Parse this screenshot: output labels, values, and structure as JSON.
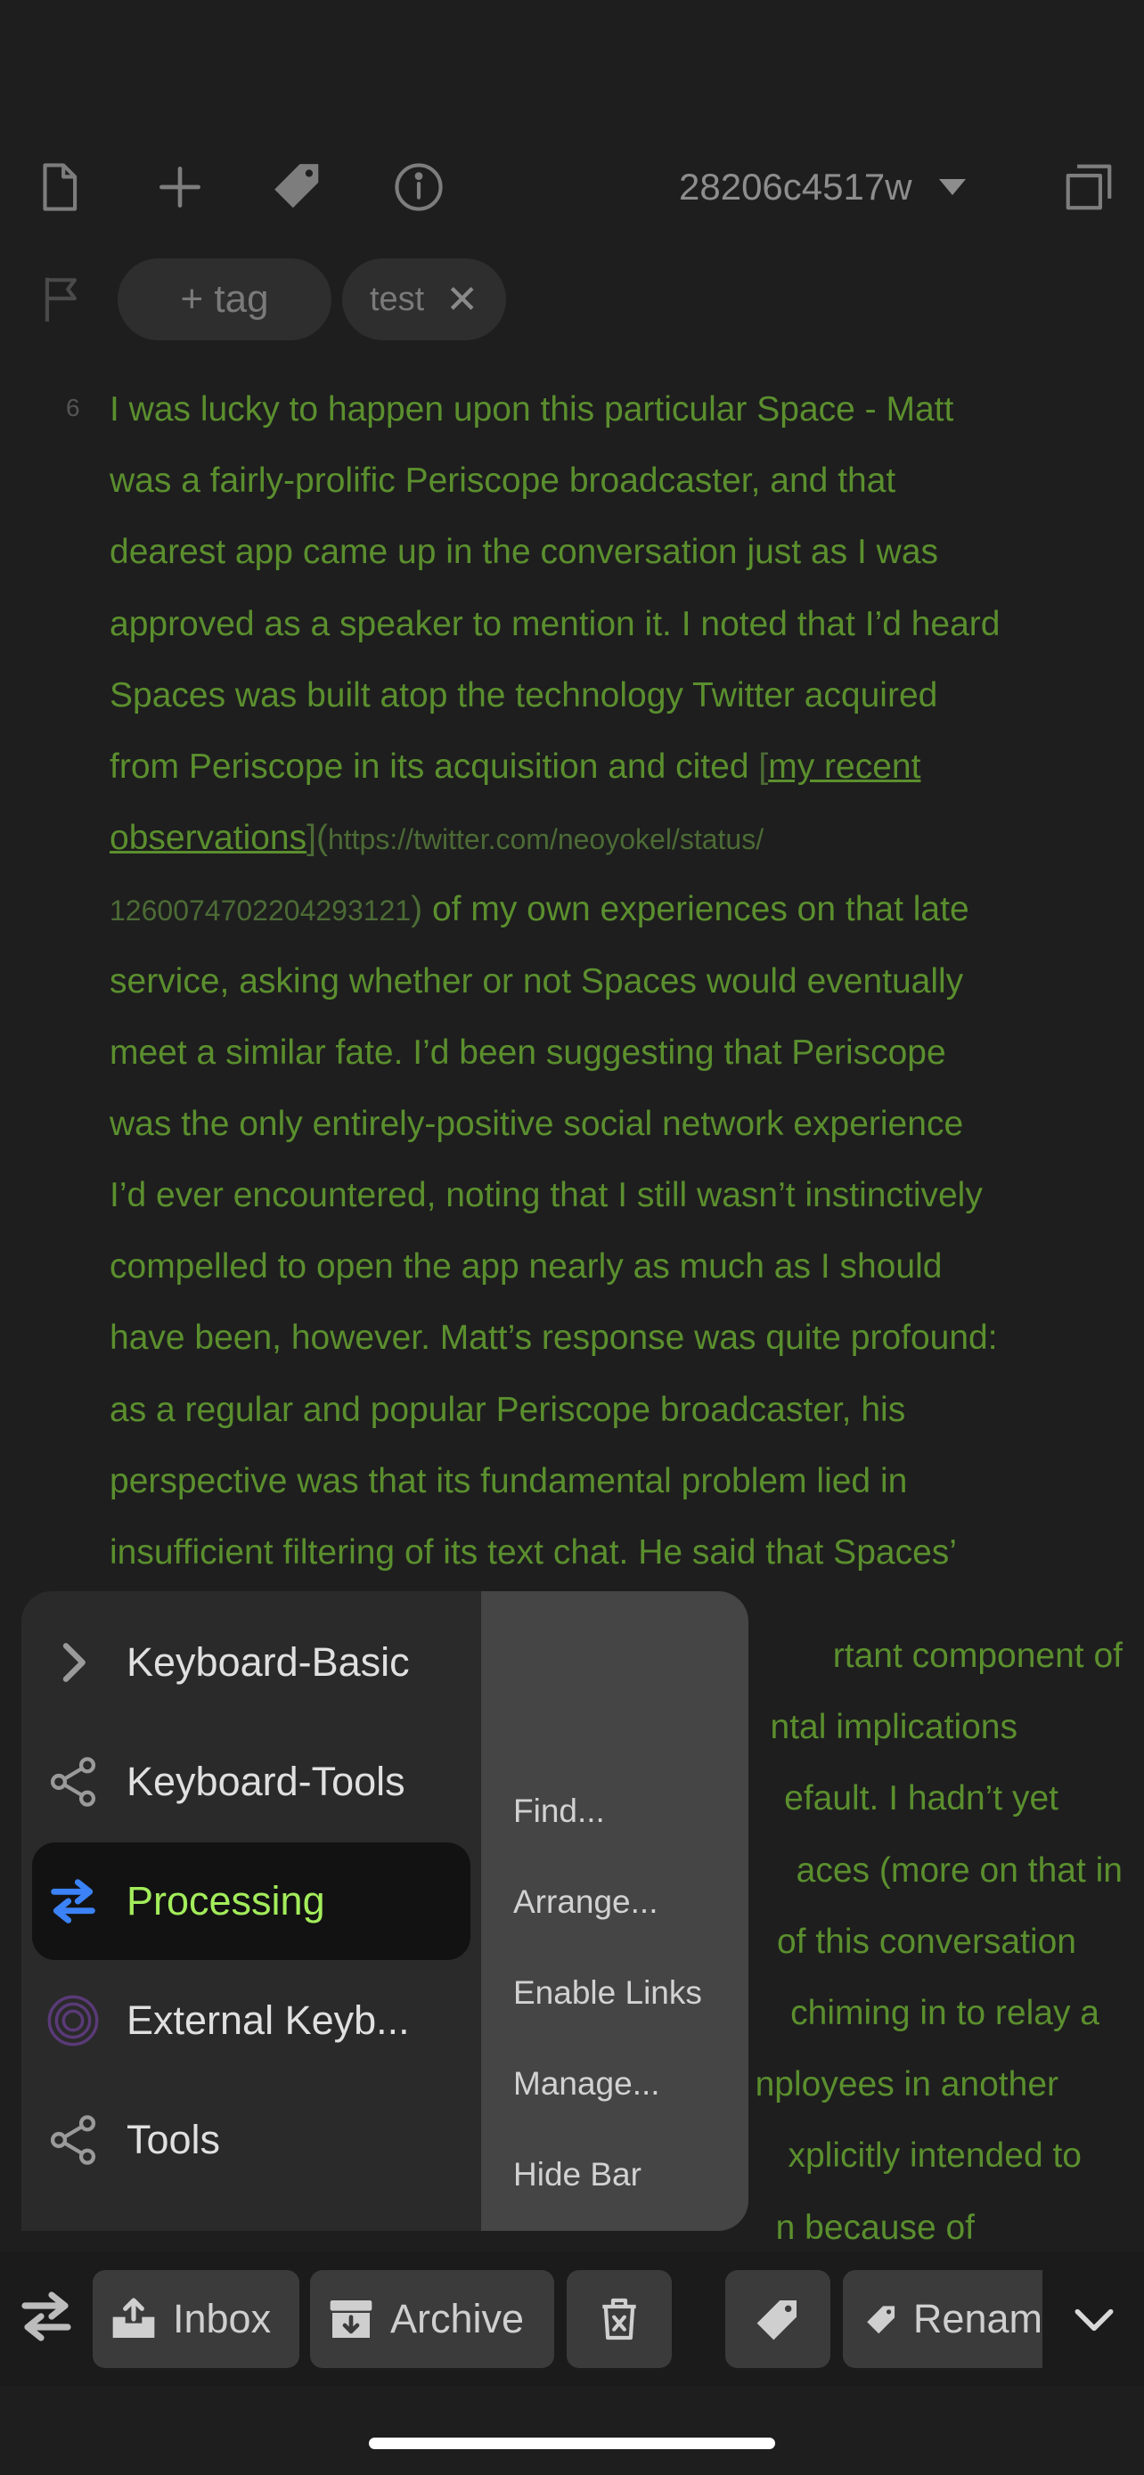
{
  "toolbar": {
    "note_id": "28206c4517w",
    "icons": [
      "document-icon",
      "plus-icon",
      "tag-icon",
      "info-icon",
      "caret-down-icon",
      "window-icon"
    ]
  },
  "tags": {
    "add_label": "+ tag",
    "items": [
      {
        "label": "test",
        "remove": "✕"
      }
    ]
  },
  "editor": {
    "line_number": "6",
    "lines": [
      "I was lucky to happen upon this particular Space - Matt",
      "was a fairly-prolific Periscope broadcaster, and that",
      "dearest app came up in the conversation just as I was",
      "approved as a speaker to mention it. I noted that I’d heard",
      "Spaces was built atop the technology Twitter acquired",
      "from Periscope in its acquisition and cited "
    ],
    "link_open": "[",
    "link_part1": "my recent",
    "link_part2": "observations",
    "link_close": "](",
    "url_part1": "https://twitter.com/neoyokel/status/",
    "url_part2": "1260074702204293121",
    "url_close": ")",
    "after_url": " of my own experiences on that late",
    "lines2": [
      "service, asking whether or not Spaces would eventually",
      "meet a similar fate. I’d been suggesting that Periscope",
      "was the only entirely-positive social network experience",
      "I’d ever encountered, noting that I still wasn’t instinctively",
      "compelled to open the app nearly as much as I should",
      "have been, however. Matt’s response was quite profound:",
      "as a regular and popular Periscope broadcaster, his",
      "perspective was that its fundamental problem lied in",
      "insufficient filtering of its text chat. He said that Spaces’"
    ],
    "partial_lines": [
      "rtant component of",
      "ntal implications",
      "efault. I hadn’t yet",
      "aces (more on that in",
      "of this conversation",
      "chiming in to relay a",
      "nployees in another",
      "xplicitly intended to",
      "n because of"
    ]
  },
  "menu": {
    "groups": [
      {
        "label": "Keyboard-Basic",
        "icon": "chevron-right-icon",
        "active": false
      },
      {
        "label": "Keyboard-Tools",
        "icon": "share-icon",
        "active": false
      },
      {
        "label": "Processing",
        "icon": "swap-arrows-icon",
        "active": true
      },
      {
        "label": "External Keyb...",
        "icon": "concentric-circles-icon",
        "active": false
      },
      {
        "label": "Tools",
        "icon": "share-icon",
        "active": false
      }
    ],
    "options": [
      "Find...",
      "Arrange...",
      "Enable Links",
      "Manage...",
      "Hide Bar"
    ]
  },
  "bottombar": {
    "inbox_label": "Inbox",
    "archive_label": "Archive",
    "rename_label": "Renam",
    "icons": [
      "swap-arrows-icon",
      "inbox-icon",
      "archive-icon",
      "trash-icon",
      "tag-icon",
      "chevron-down-icon"
    ]
  },
  "colors": {
    "background": "#1e1e1e",
    "text_green": "#5b8f2e",
    "active_green": "#a3ec5b",
    "accent_blue": "#3b82f6"
  }
}
